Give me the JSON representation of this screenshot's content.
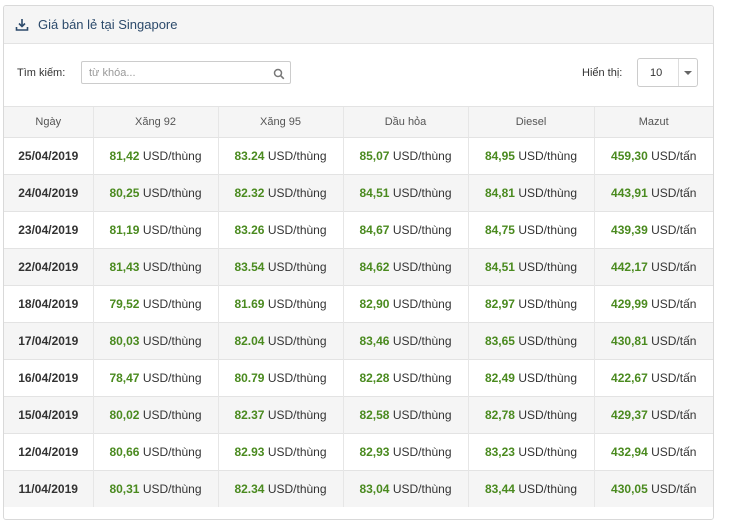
{
  "header": {
    "title": "Giá bán lẻ tại Singapore"
  },
  "toolbar": {
    "search_label": "Tìm kiếm:",
    "search_placeholder": "từ khóa...",
    "search_value": "",
    "show_label": "Hiển thị:",
    "show_value": "10"
  },
  "table": {
    "columns": [
      "Ngày",
      "Xăng 92",
      "Xăng 95",
      "Dầu hỏa",
      "Diesel",
      "Mazut"
    ],
    "rows": [
      {
        "date": "25/04/2019",
        "x92": "81,42",
        "x95": "83.24",
        "dau": "85,07",
        "diesel": "84,95",
        "mazut": "459,30"
      },
      {
        "date": "24/04/2019",
        "x92": "80,25",
        "x95": "82.32",
        "dau": "84,51",
        "diesel": "84,81",
        "mazut": "443,91"
      },
      {
        "date": "23/04/2019",
        "x92": "81,19",
        "x95": "83.26",
        "dau": "84,67",
        "diesel": "84,75",
        "mazut": "439,39"
      },
      {
        "date": "22/04/2019",
        "x92": "81,43",
        "x95": "83.54",
        "dau": "84,62",
        "diesel": "84,51",
        "mazut": "442,17"
      },
      {
        "date": "18/04/2019",
        "x92": "79,52",
        "x95": "81.69",
        "dau": "82,90",
        "diesel": "82,97",
        "mazut": "429,99"
      },
      {
        "date": "17/04/2019",
        "x92": "80,03",
        "x95": "82.04",
        "dau": "83,46",
        "diesel": "83,65",
        "mazut": "430,81"
      },
      {
        "date": "16/04/2019",
        "x92": "78,47",
        "x95": "80.79",
        "dau": "82,28",
        "diesel": "82,49",
        "mazut": "422,67"
      },
      {
        "date": "15/04/2019",
        "x92": "80,02",
        "x95": "82.37",
        "dau": "82,58",
        "diesel": "82,78",
        "mazut": "429,37"
      },
      {
        "date": "12/04/2019",
        "x92": "80,66",
        "x95": "82.93",
        "dau": "82,93",
        "diesel": "83,23",
        "mazut": "432,94"
      },
      {
        "date": "11/04/2019",
        "x92": "80,31",
        "x95": "82.34",
        "dau": "83,04",
        "diesel": "83,44",
        "mazut": "430,05"
      }
    ],
    "unit_barrel": "USD/thùng",
    "unit_ton": "USD/tấn"
  },
  "colors": {
    "header_title": "#2c4a6b",
    "value_green": "#4a8a1f",
    "alt_row": "#f5f5f5"
  },
  "icons": {
    "header": "download-icon",
    "search": "search-icon",
    "select": "caret-down-icon"
  }
}
